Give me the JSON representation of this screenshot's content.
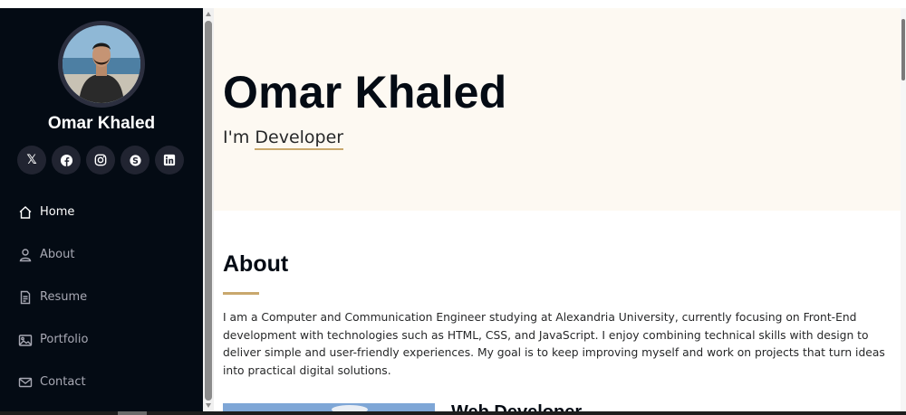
{
  "sidebar": {
    "name": "Omar Khaled",
    "socials": [
      {
        "icon": "x-twitter-icon",
        "glyph": "𝕏"
      },
      {
        "icon": "facebook-icon",
        "glyph": "f"
      },
      {
        "icon": "instagram-icon",
        "glyph": ""
      },
      {
        "icon": "skype-icon",
        "glyph": "S"
      },
      {
        "icon": "linkedin-icon",
        "glyph": "in"
      }
    ],
    "nav": [
      {
        "label": "Home",
        "icon": "house-icon",
        "active": true
      },
      {
        "label": "About",
        "icon": "person-icon",
        "active": false
      },
      {
        "label": "Resume",
        "icon": "file-text-icon",
        "active": false
      },
      {
        "label": "Portfolio",
        "icon": "images-icon",
        "active": false
      },
      {
        "label": "Contact",
        "icon": "envelope-icon",
        "active": false
      }
    ]
  },
  "hero": {
    "title": "Omar Khaled",
    "prefix": "I'm",
    "typed": "Developer"
  },
  "about": {
    "title": "About",
    "text": "I am a Computer and Communication Engineer studying at Alexandria University, currently focusing on Front-End development with technologies such as HTML, CSS, and JavaScript. I enjoy combining technical skills with design to deliver simple and user-friendly experiences. My goal is to keep improving myself and work on projects that turn ideas into practical digital solutions.",
    "role": "Web Developer"
  },
  "colors": {
    "sidebar_bg": "#040b14",
    "social_bg": "#212431",
    "accent": "#c9a86d",
    "hero_bg": "#fdf9f2",
    "nav_text": "#a8a9b4"
  }
}
